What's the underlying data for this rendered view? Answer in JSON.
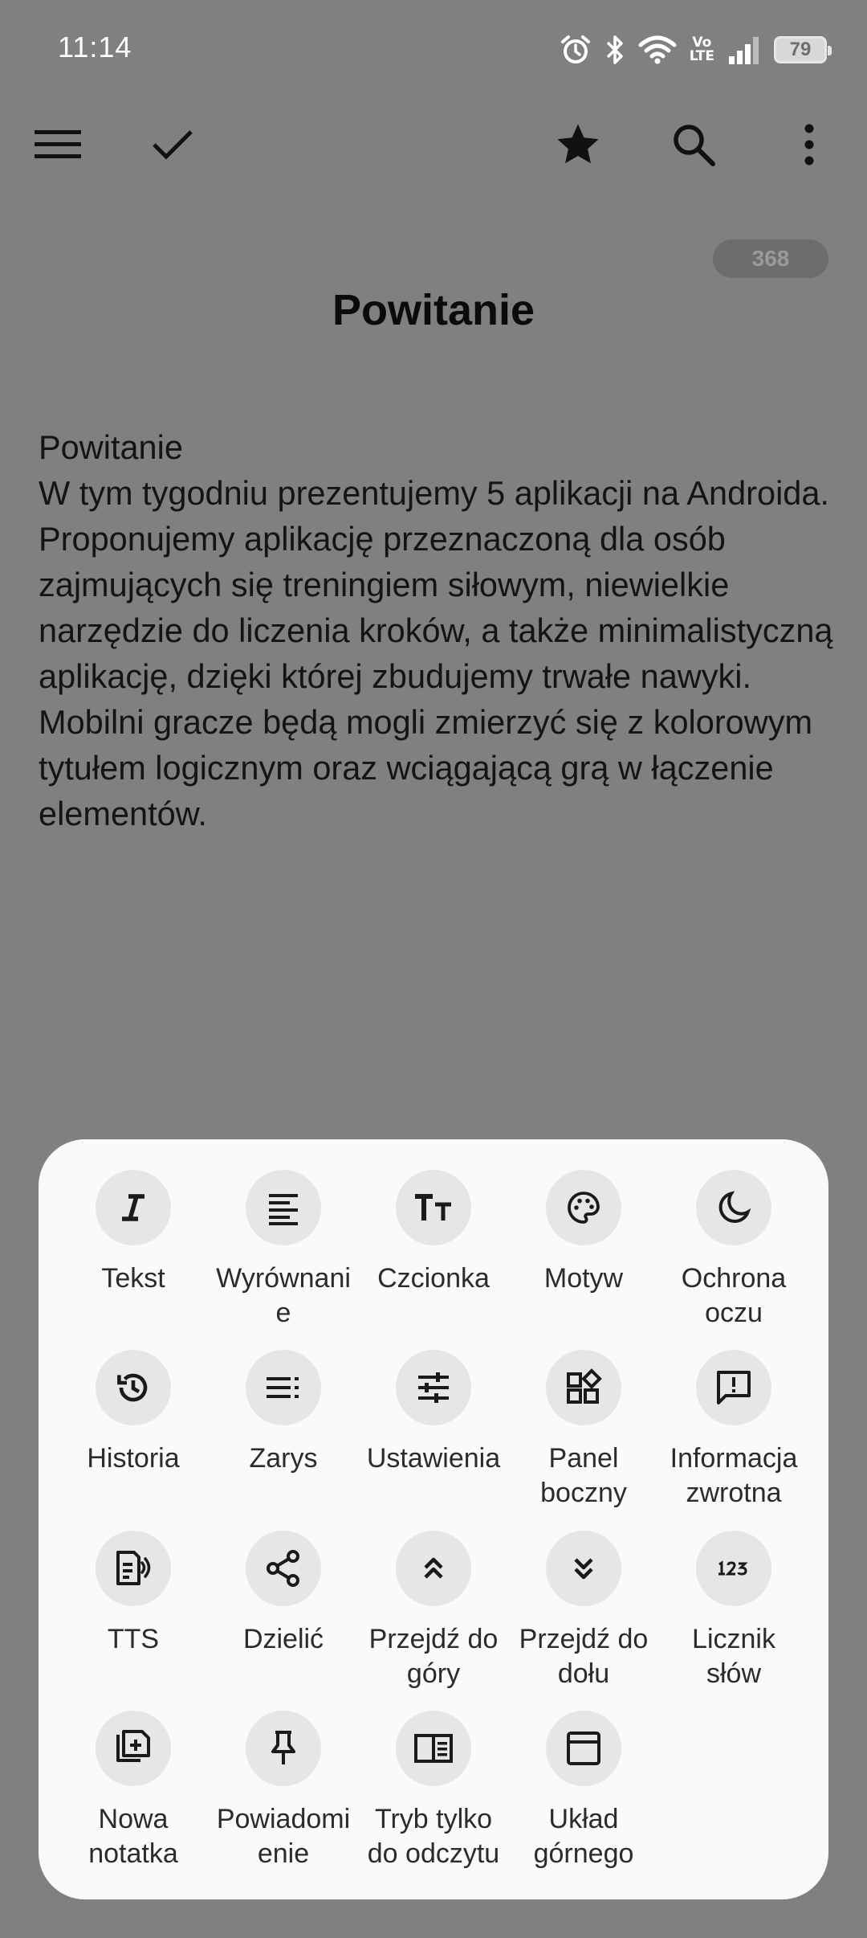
{
  "status_bar": {
    "time": "11:14",
    "volte_label": "Vo\nLTE",
    "battery_level": "79",
    "icons": [
      "alarm-icon",
      "bluetooth-icon",
      "wifi-icon",
      "volte-icon",
      "signal-icon",
      "battery-icon"
    ]
  },
  "toolbar": {
    "icons": [
      "menu-icon",
      "check-icon",
      "star-icon",
      "search-icon",
      "more-vert-icon"
    ]
  },
  "note": {
    "char_count": "368",
    "title": "Powitanie",
    "body": "Powitanie\nW tym tygodniu prezentujemy 5 aplikacji na Androida. Proponujemy aplikację przeznaczoną dla osób zajmujących się treningiem siłowym, niewielkie narzędzie do liczenia kroków, a także minimalistyczną aplikację, dzięki której zbudujemy trwałe nawyki. Mobilni gracze będą mogli zmierzyć się z kolorowym tytułem logicznym oraz wciągającą grą w łączenie elementów."
  },
  "menu": {
    "items": [
      {
        "label": "Tekst",
        "icon": "italic-text-icon"
      },
      {
        "label": "Wyrównani\ne",
        "icon": "align-left-icon"
      },
      {
        "label": "Czcionka",
        "icon": "font-size-icon"
      },
      {
        "label": "Motyw",
        "icon": "palette-icon"
      },
      {
        "label": "Ochrona\noczu",
        "icon": "moon-icon"
      },
      {
        "label": "Historia",
        "icon": "history-icon"
      },
      {
        "label": "Zarys",
        "icon": "outline-list-icon"
      },
      {
        "label": "Ustawienia",
        "icon": "sliders-icon"
      },
      {
        "label": "Panel\nboczny",
        "icon": "widgets-icon"
      },
      {
        "label": "Informacja\nzwrotna",
        "icon": "feedback-icon"
      },
      {
        "label": "TTS",
        "icon": "text-to-speech-icon"
      },
      {
        "label": "Dzielić",
        "icon": "share-icon"
      },
      {
        "label": "Przejdź do\ngóry",
        "icon": "double-chevron-up-icon"
      },
      {
        "label": "Przejdź do\ndołu",
        "icon": "double-chevron-down-icon"
      },
      {
        "label": "Licznik\nsłów",
        "icon": "number-123-icon"
      },
      {
        "label": "Nowa\nnotatka",
        "icon": "add-note-icon"
      },
      {
        "label": "Powiadomi\nenie",
        "icon": "pin-icon"
      },
      {
        "label": "Tryb tylko\ndo odczytu",
        "icon": "reader-mode-icon"
      },
      {
        "label": "Układ\ngórnego",
        "icon": "top-layout-icon"
      }
    ]
  }
}
